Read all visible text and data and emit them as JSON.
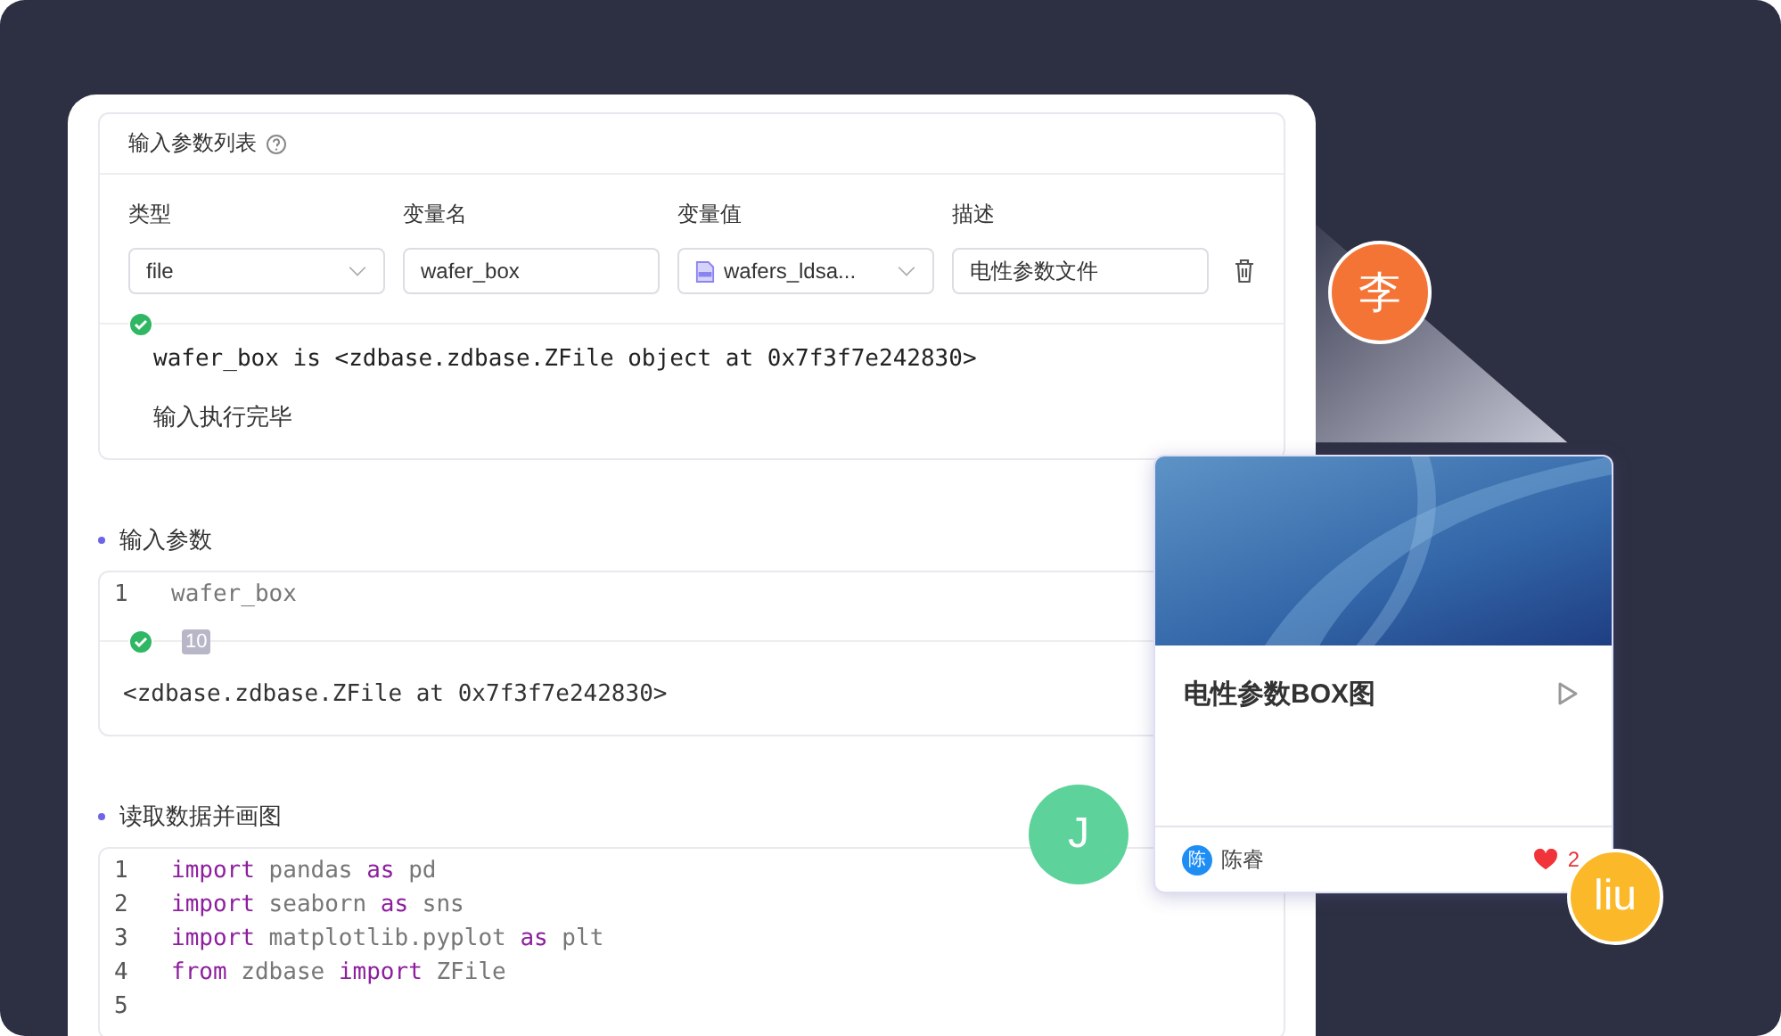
{
  "params_card": {
    "title": "输入参数列表",
    "columns": [
      "类型",
      "变量名",
      "变量值",
      "描述"
    ],
    "fields": [
      {
        "kind": "select",
        "value": "file"
      },
      {
        "kind": "input",
        "value": "wafer_box"
      },
      {
        "kind": "file-select",
        "value": "wafers_ldsa..."
      },
      {
        "kind": "input",
        "value": "电性参数文件"
      }
    ],
    "output": [
      "wafer_box is <zdbase.zdbase.ZFile object at 0x7f3f7e242830>",
      "输入执行完毕"
    ]
  },
  "sections": [
    {
      "title": "输入参数",
      "lines": [
        {
          "number": "1",
          "tokens": [
            {
              "text": "wafer_box",
              "kind": "name"
            }
          ]
        }
      ],
      "exec_count": "10",
      "output": "<zdbase.zdbase.ZFile at 0x7f3f7e242830>"
    },
    {
      "title": "读取数据并画图",
      "lines": [
        {
          "number": "1",
          "tokens": [
            {
              "text": "import",
              "kind": "keyword"
            },
            {
              "text": "pandas",
              "kind": "name"
            },
            {
              "text": "as",
              "kind": "keyword"
            },
            {
              "text": "pd",
              "kind": "name"
            }
          ]
        },
        {
          "number": "2",
          "tokens": [
            {
              "text": "import",
              "kind": "keyword"
            },
            {
              "text": "seaborn",
              "kind": "name"
            },
            {
              "text": "as",
              "kind": "keyword"
            },
            {
              "text": "sns",
              "kind": "name"
            }
          ]
        },
        {
          "number": "3",
          "tokens": [
            {
              "text": "import",
              "kind": "keyword"
            },
            {
              "text": "matplotlib.pyplot",
              "kind": "name"
            },
            {
              "text": "as",
              "kind": "keyword"
            },
            {
              "text": "plt",
              "kind": "name"
            }
          ]
        },
        {
          "number": "4",
          "tokens": [
            {
              "text": "from",
              "kind": "keyword"
            },
            {
              "text": "zdbase",
              "kind": "name"
            },
            {
              "text": "import",
              "kind": "keyword"
            },
            {
              "text": "ZFile",
              "kind": "name"
            }
          ]
        },
        {
          "number": "5"
        }
      ]
    }
  ],
  "project_card": {
    "title": "电性参数BOX图",
    "author_initial": "陈",
    "author": "陈睿",
    "likes": "2"
  },
  "avatars": [
    {
      "label": "李",
      "color": "#f47435"
    },
    {
      "label": "J",
      "color": "#5dd39b"
    },
    {
      "label": "liu",
      "color": "#fbb829"
    }
  ]
}
